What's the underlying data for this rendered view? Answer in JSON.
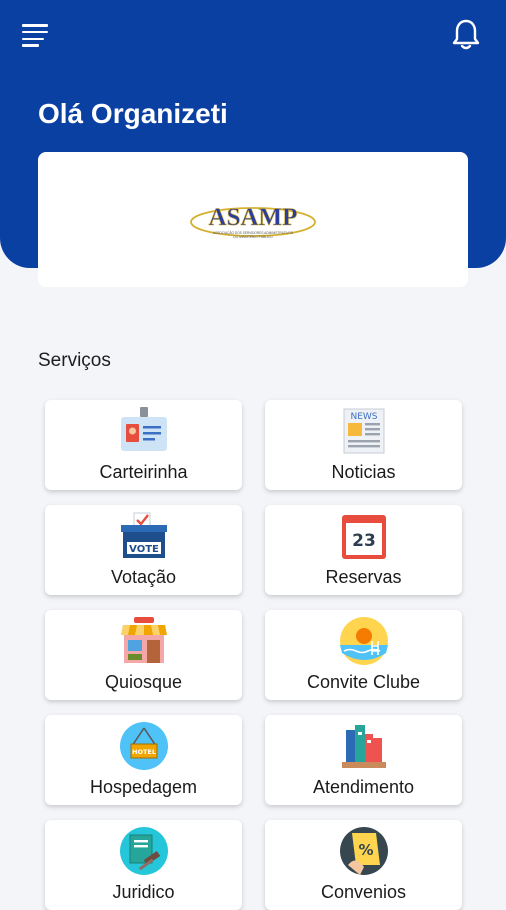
{
  "header": {
    "greeting": "Olá Organizeti",
    "menu_icon": "hamburger-menu-icon",
    "notification_icon": "bell-icon"
  },
  "logo": {
    "brand": "ASAMP",
    "tagline": "ASSOCIAÇÃO DOS SERVIDORES ADMINISTRATIVOS DO MINISTÉRIO PÚBLICO"
  },
  "section": {
    "title": "Serviços"
  },
  "services": [
    {
      "label": "Carteirinha",
      "icon": "id-card-icon"
    },
    {
      "label": "Noticias",
      "icon": "newspaper-icon"
    },
    {
      "label": "Votação",
      "icon": "ballot-box-icon"
    },
    {
      "label": "Reservas",
      "icon": "calendar-icon"
    },
    {
      "label": "Quiosque",
      "icon": "kiosk-icon"
    },
    {
      "label": "Convite Clube",
      "icon": "pool-sun-icon"
    },
    {
      "label": "Hospedagem",
      "icon": "hotel-sign-icon"
    },
    {
      "label": "Atendimento",
      "icon": "books-icon"
    },
    {
      "label": "Juridico",
      "icon": "gavel-icon"
    },
    {
      "label": "Convenios",
      "icon": "discount-coupon-icon"
    }
  ],
  "icon_text": {
    "vote": "VOTE",
    "calendar_day": "23",
    "news": "NEWS",
    "hotel": "HOTEL",
    "percent": "%"
  },
  "colors": {
    "primary": "#0b40a3",
    "background": "#f3f5f9",
    "logo_blue": "#2b3e9d",
    "logo_gold": "#d5b02e"
  }
}
